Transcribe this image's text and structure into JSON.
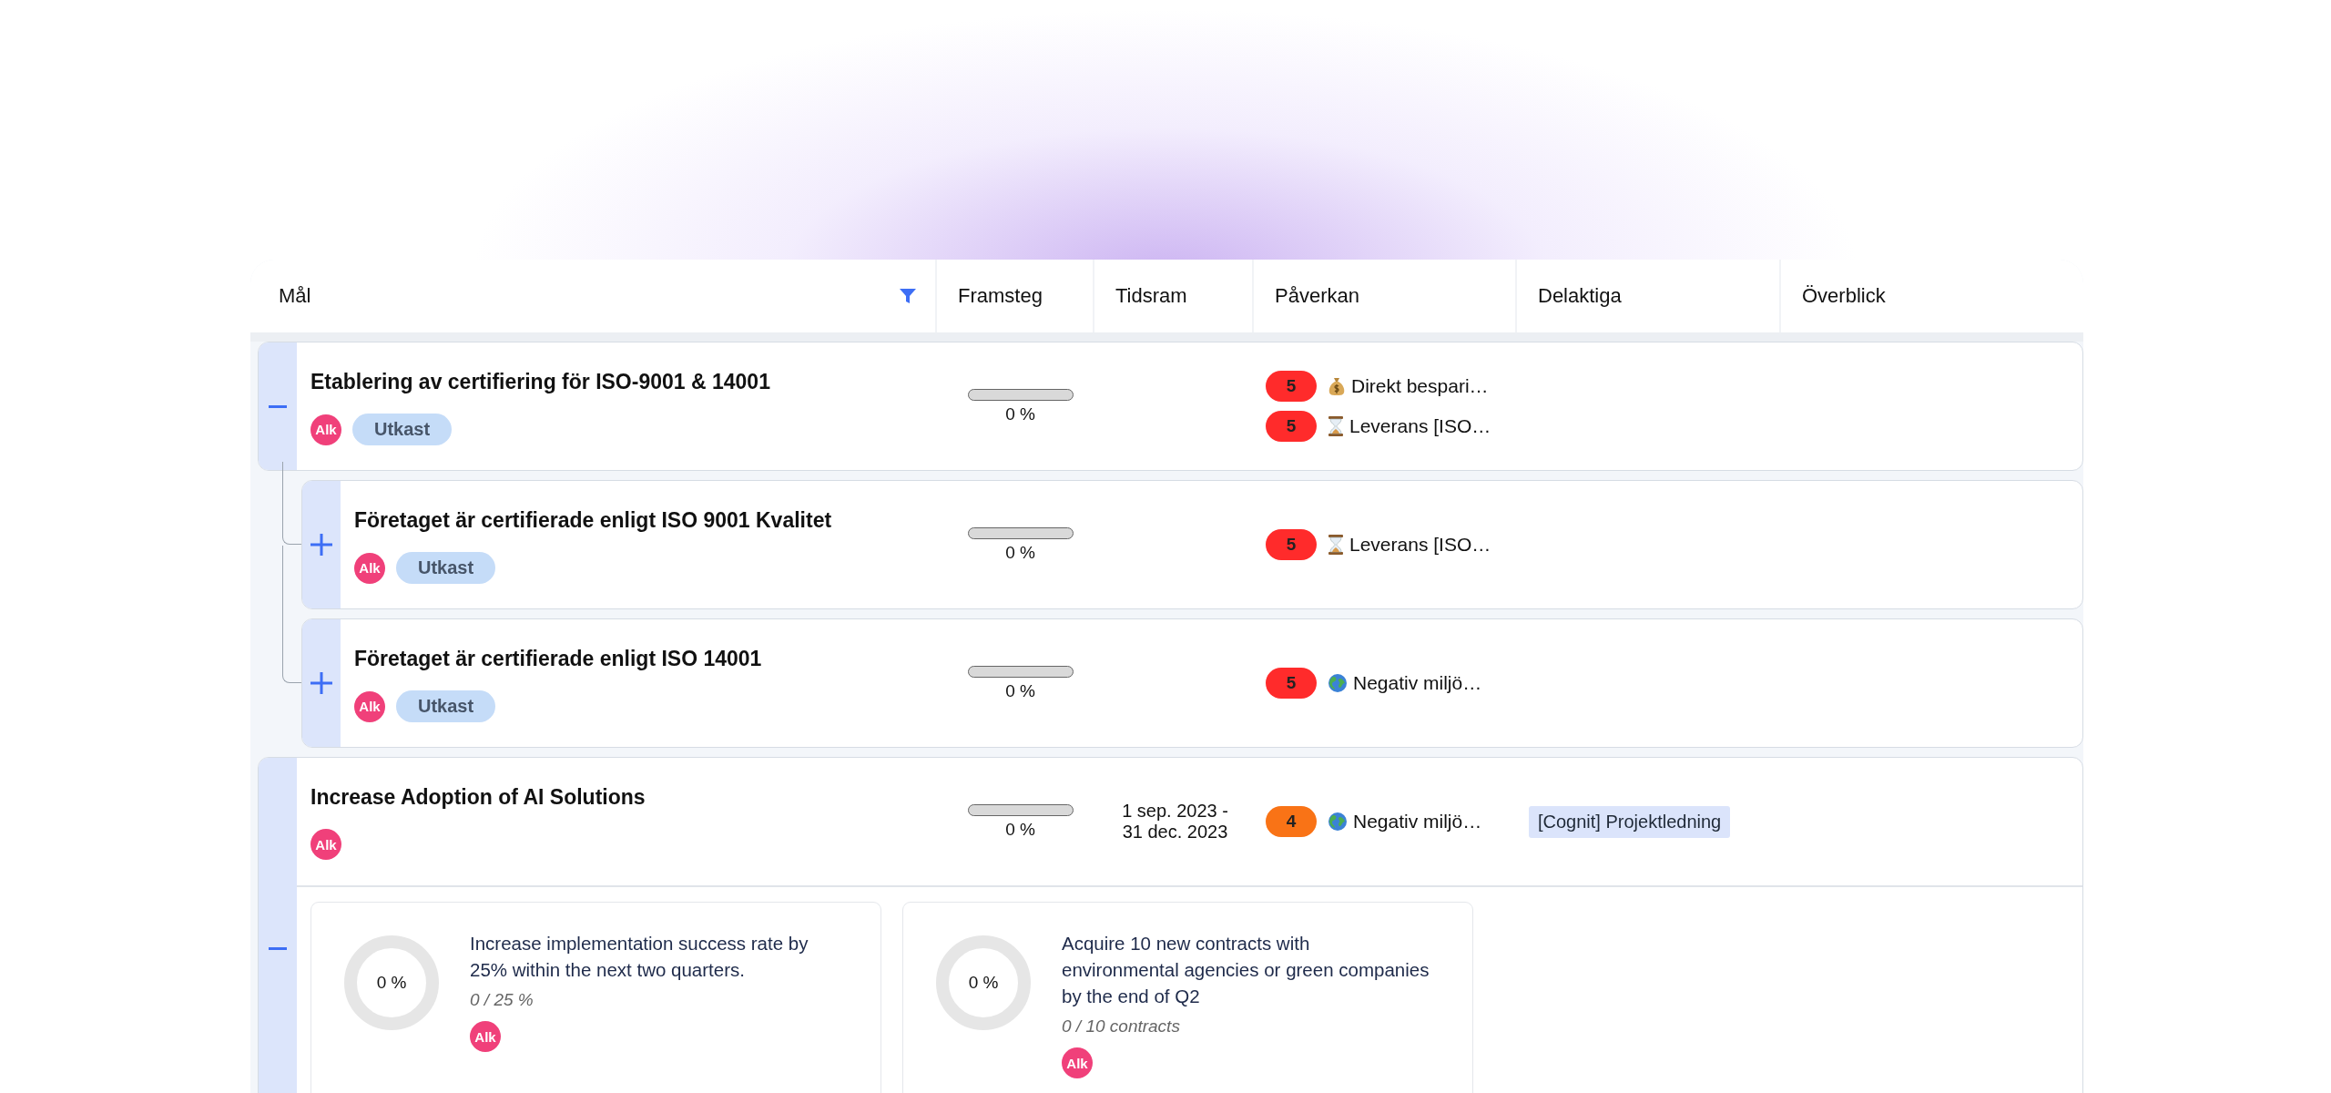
{
  "table": {
    "columns": [
      {
        "label": "Mål",
        "filter": true
      },
      {
        "label": "Framsteg",
        "filter": false
      },
      {
        "label": "Tidsram",
        "filter": false
      },
      {
        "label": "Påverkan",
        "filter": false
      },
      {
        "label": "Delaktiga",
        "filter": false
      },
      {
        "label": "Överblick",
        "filter": false
      }
    ],
    "goals": [
      {
        "title": "Etablering av certifiering för ISO-9001 & 14001",
        "expanded": true,
        "owner": "Alk",
        "status": "Utkast",
        "progress": {
          "level": 0,
          "reading": "0 %"
        },
        "impacts": [
          {
            "score": "5",
            "color": "#ff2b2b",
            "kind": "money",
            "label": "Direkt bespari…"
          },
          {
            "score": "5",
            "color": "#ff2b2b",
            "kind": "time",
            "label": "Leverans [ISO…"
          }
        ],
        "children": [
          {
            "title": "Företaget är certifierade enligt ISO 9001 Kvalitet",
            "expanded": false,
            "owner": "Alk",
            "status": "Utkast",
            "progress": {
              "level": 0,
              "reading": "0 %"
            },
            "impacts": [
              {
                "score": "5",
                "color": "#ff2b2b",
                "kind": "time",
                "label": "Leverans [ISO…"
              }
            ]
          },
          {
            "title": "Företaget är certifierade enligt ISO 14001",
            "expanded": false,
            "owner": "Alk",
            "status": "Utkast",
            "progress": {
              "level": 0,
              "reading": "0 %"
            },
            "impacts": [
              {
                "score": "5",
                "color": "#ff2b2b",
                "kind": "globe",
                "label": "Negativ miljö…"
              }
            ]
          }
        ]
      },
      {
        "title": "Increase Adoption of AI Solutions",
        "expanded": true,
        "owner": "Alk",
        "progress": {
          "level": 0,
          "reading": "0 %"
        },
        "timeframe": "1 sep. 2023 -\n31 dec. 2023",
        "impacts": [
          {
            "score": "4",
            "color": "#f97316",
            "kind": "globe",
            "label": "Negativ miljö…"
          }
        ],
        "participants": [
          "[Cognit] Projektledning"
        ],
        "key_results": [
          {
            "level": 0,
            "reading": "0 %",
            "title": "Increase implementation success rate by 25% within the next two quarters.",
            "value": "0 / 25 %",
            "owner": "Alk"
          },
          {
            "level": 0,
            "reading": "0 %",
            "title": "Acquire 10 new contracts with environmental agencies or green companies by the end of Q2",
            "value": "0 / 10 contracts",
            "owner": "Alk"
          }
        ]
      }
    ]
  }
}
